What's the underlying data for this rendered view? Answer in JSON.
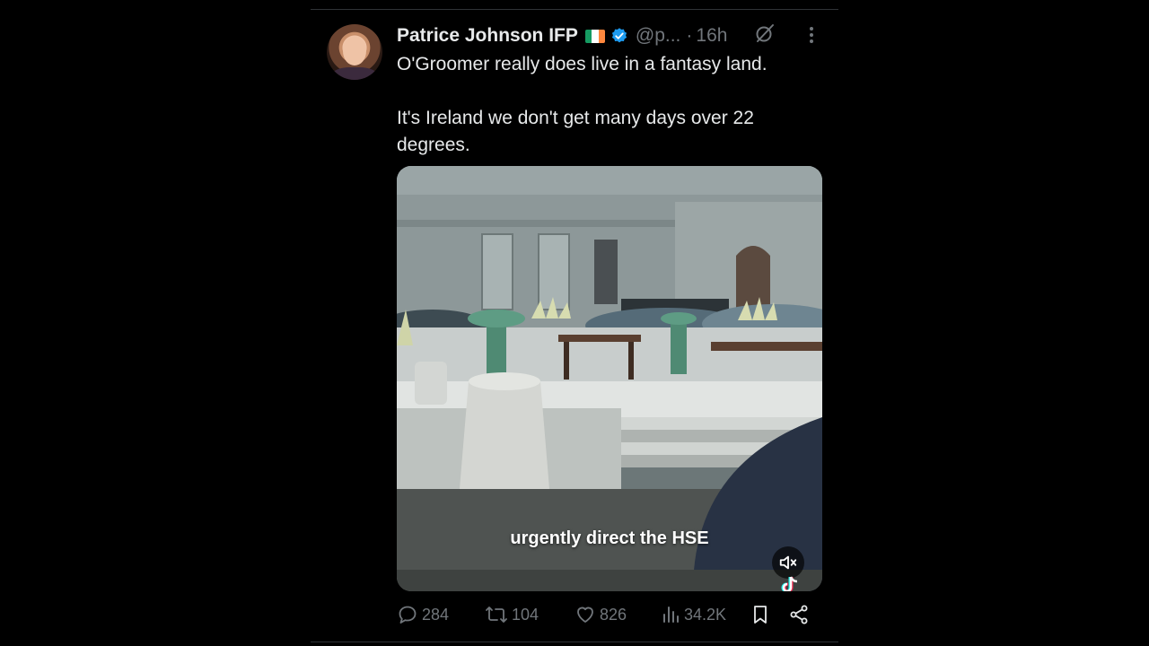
{
  "tweet": {
    "author_name": "Patrice Johnson IFP",
    "handle": "@p...",
    "separator": "·",
    "time": "16h",
    "paragraphs": [
      "O'Groomer really does live in a fantasy land.",
      "It's Ireland we don't get many days over 22 degrees."
    ],
    "flag_colors": [
      "#169b62",
      "#ffffff",
      "#ff883e"
    ],
    "verified_color": "#1d9bf0"
  },
  "media": {
    "caption": "urgently direct the HSE",
    "mute_icon": "volume-muted-icon",
    "watermark_icon": "tiktok-icon"
  },
  "actions": {
    "replies": "284",
    "reposts": "104",
    "likes": "826",
    "views": "34.2K",
    "bookmark_icon": "bookmark-icon",
    "share_icon": "share-icon"
  },
  "colors": {
    "background": "#000000",
    "text_primary": "#e7e9ea",
    "text_secondary": "#71767b",
    "border": "#2f3336"
  }
}
